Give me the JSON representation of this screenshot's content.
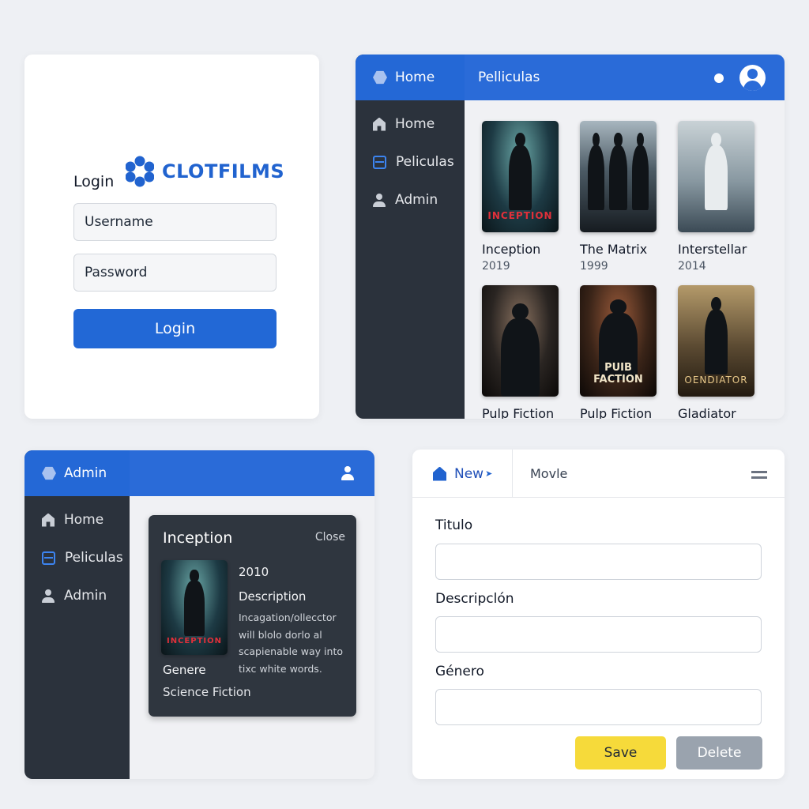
{
  "login": {
    "brand_name": "CLOTFILMS",
    "title": "Login",
    "username_placeholder": "Username",
    "password_placeholder": "Password",
    "button_label": "Login"
  },
  "movies_view": {
    "header_home": "Home",
    "page_title": "Pelliculas",
    "sidebar": [
      {
        "label": "Home",
        "icon": "home-icon"
      },
      {
        "label": "Peliculas",
        "icon": "film-icon"
      },
      {
        "label": "Admin",
        "icon": "user-icon"
      }
    ],
    "movies": [
      {
        "title": "Inception",
        "year": "2019",
        "poster_text": "INCEPTION",
        "poster_text_color": "#e0303a"
      },
      {
        "title": "The Matrix",
        "year": "1999",
        "poster_text": "",
        "poster_text_color": "#ffffff"
      },
      {
        "title": "Interstellar",
        "year": "2014",
        "poster_text": "",
        "poster_text_color": "#5a4a2a"
      },
      {
        "title": "Pulp Fiction",
        "year": "",
        "poster_text": "",
        "poster_text_color": "#ffffff"
      },
      {
        "title": "Pulp Fiction",
        "year": "",
        "poster_text": "PUIB FACTION",
        "poster_text_color": "#f2e6c8"
      },
      {
        "title": "Gladiator",
        "year": "",
        "poster_text": "OENDIATOR",
        "poster_text_color": "#e9c98a"
      }
    ]
  },
  "admin_view": {
    "header_label": "Admin",
    "sidebar": [
      {
        "label": "Home",
        "icon": "home-icon"
      },
      {
        "label": "Peliculas",
        "icon": "film-icon"
      },
      {
        "label": "Admin",
        "icon": "user-icon"
      }
    ],
    "detail": {
      "title": "Inception",
      "close_label": "Close",
      "poster_text": "INCEPTION",
      "year": "2010",
      "description_label": "Description",
      "description": "Incagation/ollecctor will blolo dorlo al scapienable way into tixc white words.",
      "genre_label": "Genere",
      "genre": "Science Fiction"
    }
  },
  "edit_form": {
    "tab_new": "New",
    "tab_movie": "Movle",
    "fields": [
      {
        "label": "Titulo",
        "value": ""
      },
      {
        "label": "Descripclón",
        "value": ""
      },
      {
        "label": "Género",
        "value": ""
      }
    ],
    "save_label": "Save",
    "delete_label": "Delete"
  },
  "colors": {
    "primary": "#2268d6",
    "sidebar": "#2b323c",
    "save": "#f6da3a",
    "delete": "#9aa3ae"
  }
}
